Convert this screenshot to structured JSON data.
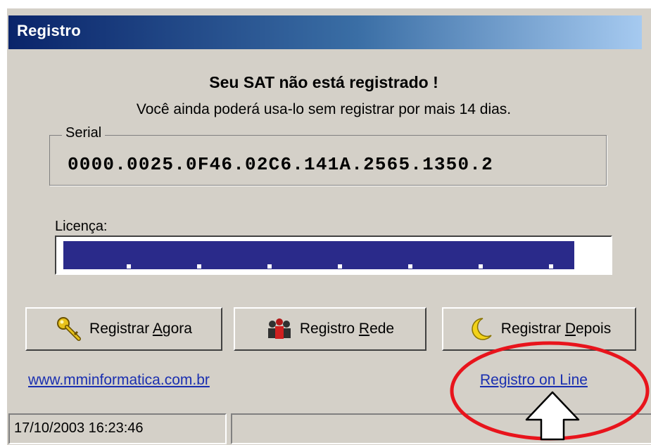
{
  "window": {
    "title": "Registro"
  },
  "message": {
    "heading": "Seu SAT não está registrado !",
    "subheading": "Você ainda poderá usa-lo sem registrar por mais 14 dias."
  },
  "serial": {
    "label": "Serial",
    "value": "0000.0025.0F46.02C6.141A.2565.1350.2"
  },
  "license": {
    "label": "Licença:",
    "value": "",
    "selected": true
  },
  "buttons": {
    "register_now": {
      "pre": "Registrar ",
      "key": "A",
      "post": "gora",
      "icon": "key-icon"
    },
    "register_network": {
      "pre": "Registro ",
      "key": "R",
      "post": "ede",
      "icon": "network-users-icon"
    },
    "register_later": {
      "pre": "Registrar ",
      "key": "D",
      "post": "epois",
      "icon": "moon-icon"
    }
  },
  "links": {
    "website": "www.mminformatica.com.br",
    "online": "Registro on Line"
  },
  "statusbar": {
    "datetime": "17/10/2003 16:23:46",
    "panel2": ""
  },
  "annotation": {
    "circle_color": "#e8141c",
    "arrow": "up-arrow-icon"
  },
  "colors": {
    "titlebar_start": "#0a246a",
    "titlebar_end": "#a6caf0",
    "face": "#d4d0c8",
    "selection": "#2a2a8a",
    "link": "#1a2fb0"
  }
}
